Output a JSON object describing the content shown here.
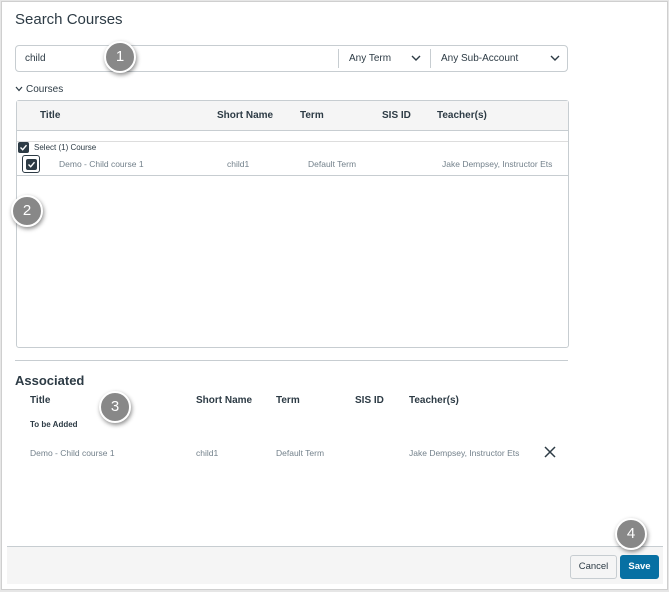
{
  "title": "Search Courses",
  "search": {
    "value": "child",
    "term": "Any Term",
    "subaccount": "Any Sub-Account"
  },
  "courses_section": {
    "label": "Courses"
  },
  "results": {
    "columns": [
      "Title",
      "Short Name",
      "Term",
      "SIS ID",
      "Teacher(s)"
    ],
    "select_all": "Select (1) Course",
    "rows": [
      {
        "title": "Demo - Child course 1",
        "short_name": "child1",
        "term": "Default Term",
        "sis_id": "",
        "teachers": "Jake Dempsey, Instructor Ets"
      }
    ]
  },
  "associated": {
    "heading": "Associated",
    "columns": [
      "Title",
      "Short Name",
      "Term",
      "SIS ID",
      "Teacher(s)"
    ],
    "group_label": "To be Added",
    "rows": [
      {
        "title": "Demo - Child course 1",
        "short_name": "child1",
        "term": "Default Term",
        "sis_id": "",
        "teachers": "Jake Dempsey, Instructor Ets"
      }
    ]
  },
  "footer": {
    "cancel": "Cancel",
    "save": "Save"
  },
  "markers": [
    "1",
    "2",
    "3",
    "4"
  ],
  "colors": {
    "primary": "#0770a3",
    "text": "#2d3b45",
    "muted": "#73818b",
    "border": "#c7cdd1",
    "marker": "#888888"
  }
}
